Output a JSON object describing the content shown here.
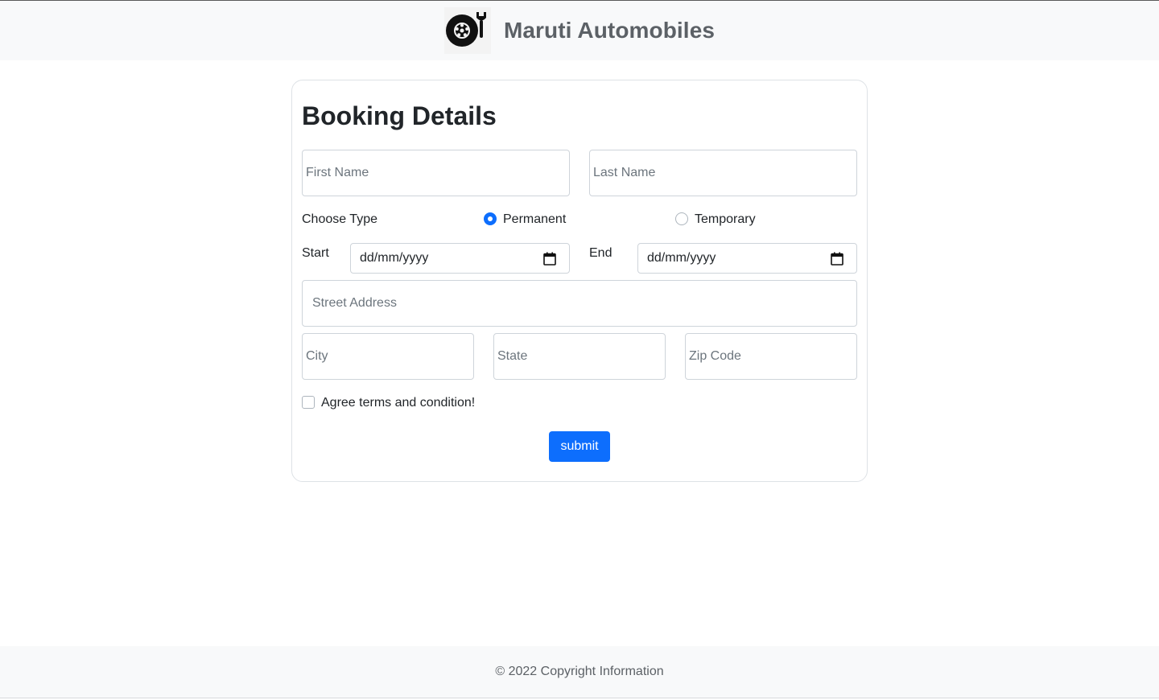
{
  "header": {
    "logo_icon": "wheel-wrench-icon",
    "brand_name": "Maruti Automobiles"
  },
  "form": {
    "title": "Booking Details",
    "first_name": {
      "placeholder": "First Name",
      "value": ""
    },
    "last_name": {
      "placeholder": "Last Name",
      "value": ""
    },
    "choose_type_label": "Choose Type",
    "type_options": [
      {
        "label": "Permanent",
        "checked": true
      },
      {
        "label": "Temporary",
        "checked": false
      }
    ],
    "start_label": "Start",
    "start_date": {
      "placeholder": "dd/mm/yyyy"
    },
    "end_label": "End",
    "end_date": {
      "placeholder": "dd/mm/yyyy"
    },
    "street": {
      "placeholder": "Street Address"
    },
    "city": {
      "placeholder": "City"
    },
    "state": {
      "placeholder": "State"
    },
    "zip": {
      "placeholder": "Zip Code"
    },
    "terms_label": "Agree terms and condition!",
    "terms_checked": false,
    "submit_label": "submit"
  },
  "footer": {
    "copyright": "© 2022 Copyright Information"
  },
  "colors": {
    "primary": "#0d6efd",
    "navbar_bg": "#f8f9fa",
    "brand_text": "#5c6166"
  }
}
